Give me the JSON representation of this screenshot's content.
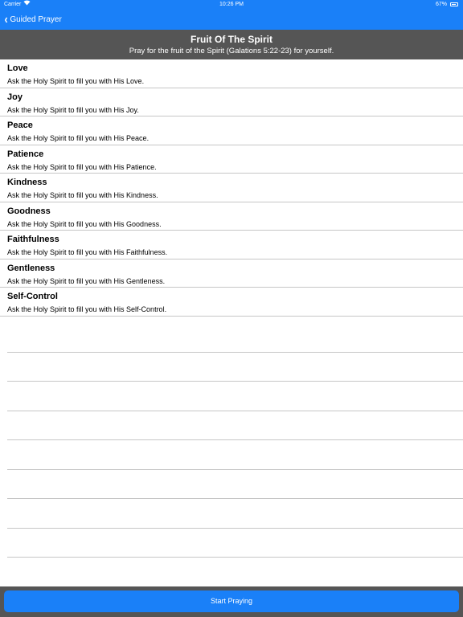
{
  "status_bar": {
    "carrier": "Carrier",
    "time": "10:26 PM",
    "battery": "67%"
  },
  "nav": {
    "back_label": "Guided Prayer"
  },
  "header": {
    "title": "Fruit Of The Spirit",
    "subtitle": "Pray for the fruit of the Spirit (Galations 5:22-23) for yourself."
  },
  "items": [
    {
      "name": "Love",
      "desc": "Ask the Holy Spirit to fill you with His Love."
    },
    {
      "name": "Joy",
      "desc": "Ask the Holy Spirit to fill you with His Joy."
    },
    {
      "name": "Peace",
      "desc": "Ask the Holy Spirit to fill you with His Peace."
    },
    {
      "name": "Patience",
      "desc": "Ask the Holy Spirit to fill you with His Patience."
    },
    {
      "name": "Kindness",
      "desc": "Ask the Holy Spirit to fill you with His Kindness."
    },
    {
      "name": "Goodness",
      "desc": "Ask the Holy Spirit to fill you with His Goodness."
    },
    {
      "name": "Faithfulness",
      "desc": "Ask the Holy Spirit to fill you with His Faithfulness."
    },
    {
      "name": "Gentleness",
      "desc": "Ask the Holy Spirit to fill you with His Gentleness."
    },
    {
      "name": "Self-Control",
      "desc": "Ask the Holy Spirit to fill you with His Self-Control."
    }
  ],
  "footer": {
    "start_label": "Start Praying"
  },
  "colors": {
    "accent": "#1a80f8",
    "header_bg": "#555555",
    "divider": "#c6c6c6"
  },
  "icons": {
    "back": "chevron-left-icon",
    "wifi": "wifi-icon",
    "battery": "battery-icon"
  }
}
